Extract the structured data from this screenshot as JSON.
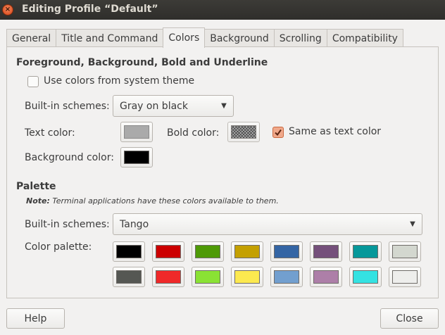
{
  "window": {
    "title": "Editing Profile “Default”"
  },
  "tabs": [
    {
      "label": "General"
    },
    {
      "label": "Title and Command"
    },
    {
      "label": "Colors"
    },
    {
      "label": "Background"
    },
    {
      "label": "Scrolling"
    },
    {
      "label": "Compatibility"
    }
  ],
  "fg_section": {
    "title": "Foreground, Background, Bold and Underline",
    "use_system_label": "Use colors from system theme",
    "use_system_checked": false,
    "schemes_label": "Built-in schemes:",
    "schemes_value": "Gray on black",
    "text_color_label": "Text color:",
    "text_color": "#aaaaaa",
    "bold_color_label": "Bold color:",
    "bold_color": "#aaaaaa",
    "same_as_text_label": "Same as text color",
    "same_as_text_checked": true,
    "bg_color_label": "Background color:",
    "bg_color": "#000000"
  },
  "palette_section": {
    "title": "Palette",
    "note_bold": "Note:",
    "note_text": " Terminal applications have these colors available to them.",
    "schemes_label": "Built-in schemes:",
    "schemes_value": "Tango",
    "palette_label": "Color palette:",
    "colors": [
      "#000000",
      "#cc0000",
      "#4e9a06",
      "#c4a000",
      "#3465a4",
      "#75507b",
      "#06989a",
      "#d3d7cf",
      "#555753",
      "#ef2929",
      "#8ae234",
      "#fce94f",
      "#729fcf",
      "#ad7fa8",
      "#34e2e2",
      "#eeeeec"
    ]
  },
  "footer": {
    "help_label": "Help",
    "close_label": "Close"
  },
  "colors": {
    "accent": "#e0572a",
    "titlebar": "#3c3b37",
    "background": "#f2f1f0"
  }
}
